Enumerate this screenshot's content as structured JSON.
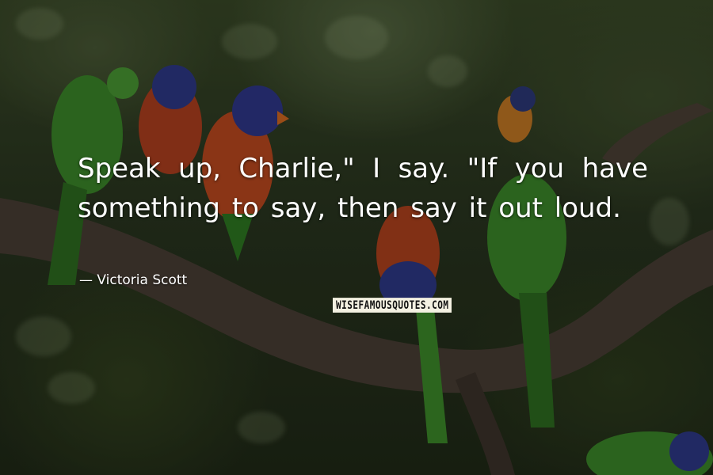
{
  "quote": {
    "text": "Speak up, Charlie,\" I say. \"If you have something to say, then say it out loud.",
    "author_line": "— Victoria Scott"
  },
  "watermark": "WISEFAMOUSQUOTES.COM",
  "colors": {
    "text": "#ffffff",
    "foliage_dark": "#202a17",
    "branch": "#4a3f35",
    "parrot_green": "#3c8a2a",
    "parrot_red": "#b2401f",
    "parrot_blue": "#2f3a8a"
  }
}
